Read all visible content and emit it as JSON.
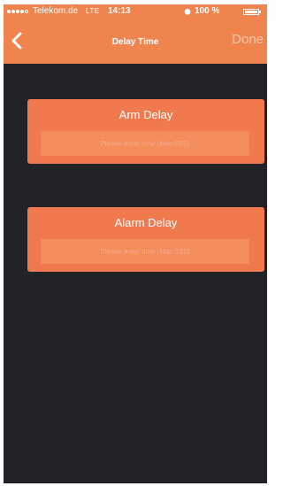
{
  "status_bar": {
    "carrier": "Telekom.de",
    "network": "LTE",
    "time": "14:13",
    "battery_text": "100 %",
    "signal_bars_filled": 4,
    "signal_bars_total": 5
  },
  "nav": {
    "title": "Delay Time",
    "back_icon": "chevron-left-icon",
    "done_label": "Done"
  },
  "arm_delay": {
    "title": "Arm Delay",
    "input_value": "",
    "placeholder": "Please enter time (Max:59S)"
  },
  "alarm_delay": {
    "title": "Alarm Delay",
    "input_value": "",
    "placeholder": "Please enter time (Max:59S)"
  },
  "colors": {
    "accent": "#f0844f",
    "card": "#f07a4e",
    "background": "#222229"
  }
}
